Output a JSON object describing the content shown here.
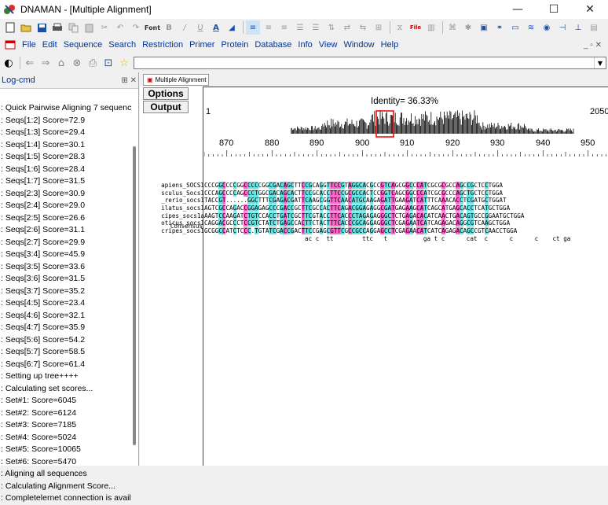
{
  "window": {
    "title": "DNAMAN - [Multiple Alignment]",
    "controls": [
      "—",
      "☐",
      "✕"
    ]
  },
  "menu": [
    "File",
    "Edit",
    "Sequence",
    "Search",
    "Restriction",
    "Primer",
    "Protein",
    "Database",
    "Info",
    "View",
    "Window",
    "Help"
  ],
  "toolbar_font_label": "Font",
  "toolbar_file_label": "File",
  "left_panel": {
    "title": "Log-cmd",
    "lines": [
      ": Quick Pairwise Aligning 7 sequenc",
      ": Seqs[1:2] Score=72.9",
      ": Seqs[1:3] Score=29.4",
      ": Seqs[1:4] Score=30.1",
      ": Seqs[1:5] Score=28.3",
      ": Seqs[1:6] Score=28.4",
      ": Seqs[1:7] Score=31.5",
      ": Seqs[2:3] Score=30.9",
      ": Seqs[2:4] Score=29.0",
      ": Seqs[2:5] Score=26.6",
      ": Seqs[2:6] Score=31.1",
      ": Seqs[2:7] Score=29.9",
      ": Seqs[3:4] Score=45.9",
      ": Seqs[3:5] Score=33.6",
      ": Seqs[3:6] Score=31.5",
      ": Seqs[3:7] Score=35.2",
      ": Seqs[4:5] Score=23.4",
      ": Seqs[4:6] Score=32.1",
      ": Seqs[4:7] Score=35.9",
      ": Seqs[5:6] Score=54.2",
      ": Seqs[5:7] Score=58.5",
      ": Seqs[6:7] Score=61.4",
      ": Setting up tree++++",
      ": Calculating set scores...",
      ": Set#1: Score=6045",
      ": Set#2: Score=6124",
      ": Set#3: Score=7185",
      ": Set#4: Score=5024",
      ": Set#5: Score=10065",
      ": Set#6: Score=5470",
      ": Aligning all sequences",
      ": Calculating Alignment Score...",
      ": Completelernet connection is avail"
    ]
  },
  "document": {
    "tab_label": "Multiple Alignment",
    "options_label": "Options",
    "output_label": "Output",
    "identity": "Identity= 36.33%",
    "start_pos": "1",
    "end_pos": "2050",
    "ruler": [
      "870",
      "880",
      "890",
      "900",
      "910",
      "920",
      "930",
      "940",
      "950"
    ],
    "sequences": [
      {
        "name": "apiens_SOCS1",
        "seq": "CCCGGCCCCGGCCCCCGGCGACAGCTTCCGCAGGTTCCGTAGGCACGCCGTCAGCGGCCCATCGCGCGCCAGCCGCTCCTGGA"
      },
      {
        "name": "sculus_Socs1",
        "seq": "CCCAGCCCCAGCCCTGGCGACAGCACTTCCGCACCTTCCGCGCCACTCCGGTCAGCGGCCCATCGCGCCCAGCTGCTCCTGGA"
      },
      {
        "name": "_rerio_socs1",
        "seq": "TACCGT......GGCTTTCGAGACGATTCAAGCGGTTCAACATGCAAGAGATTGAAGATCATTTCAAACACCTCGATGCTGGAT"
      },
      {
        "name": "ilatus_socs1",
        "seq": "AGTCGCCAGACCGGAGAGCCCGACCGCTTCGCCACTTCAGACGGAGAGGCGATGAGAAGCATCAGCATGAGCACCTCATGCTGGA"
      },
      {
        "name": "cipes_socs1a",
        "seq": "AAGTCCAAGATCTGTCCACCTGATCGCTTCGTACCTTCACCCTAGAGAGGGCTCTGAGACACATCAACTGACAGTGCCGGAATGCTGGA"
      },
      {
        "name": "oticus_socs1",
        "seq": "CAGGACGCCCTCCGTCTATCTGAGCCACTTCTACTTTCACCCGCAGGAGGGCTCGAGAATCATCAGAGACAGGCGTCAAGCTGGA"
      },
      {
        "name": "cripes_socs1",
        "seq": "GCGGCCATCTCCC.TGTATCGACCGACTTCCGAGCGTTCGCCGCCAGGAGCCTCGAGAACATCATCAGAGACAGCCGTCAACCTGGA"
      }
    ],
    "consensus_label": "Consensus",
    "consensus": "                          ac c  tt        ttc   t          ga t c      cat  c      c      c    ct ga"
  }
}
